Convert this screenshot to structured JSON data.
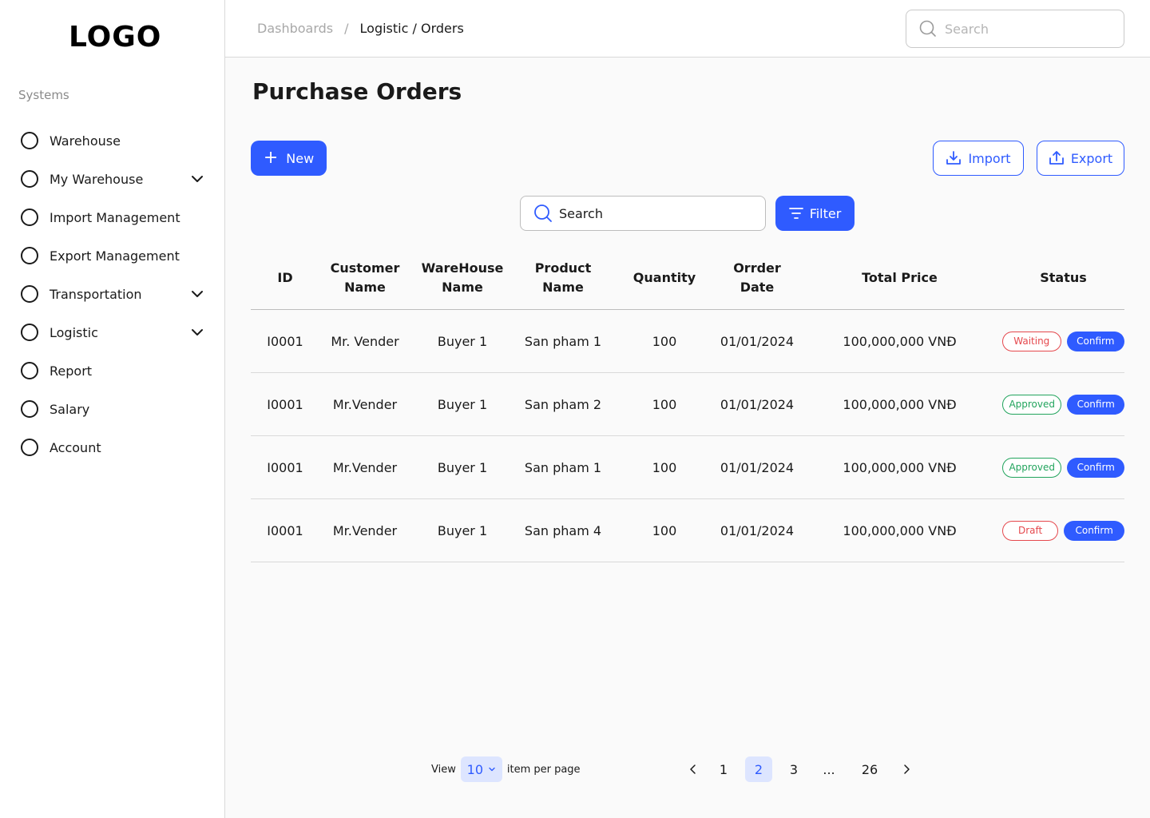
{
  "brand": {
    "logo": "LOGO"
  },
  "sidebar": {
    "section_label": "Systems",
    "items": [
      {
        "label": "Warehouse",
        "has_chevron": false
      },
      {
        "label": "My Warehouse",
        "has_chevron": true
      },
      {
        "label": "Import Management",
        "has_chevron": false
      },
      {
        "label": "Export Management",
        "has_chevron": false
      },
      {
        "label": "Transportation",
        "has_chevron": true
      },
      {
        "label": "Logistic",
        "has_chevron": true
      },
      {
        "label": "Report",
        "has_chevron": false
      },
      {
        "label": "Salary",
        "has_chevron": false
      },
      {
        "label": "Account",
        "has_chevron": false
      }
    ]
  },
  "header": {
    "breadcrumb": {
      "root": "Dashboards",
      "separator": "/",
      "current": "Logistic / Orders"
    },
    "search_placeholder": "Search"
  },
  "page": {
    "title": "Purchase Orders"
  },
  "toolbar": {
    "new_label": "New",
    "import_label": "Import",
    "export_label": "Export",
    "search_placeholder": "Search",
    "filter_label": "Filter"
  },
  "table": {
    "headers": {
      "id": "ID",
      "customer_line1": "Customer",
      "customer_line2": "Name",
      "warehouse_line1": "WareHouse",
      "warehouse_line2": "Name",
      "product_line1": "Product",
      "product_line2": "Name",
      "quantity": "Quantity",
      "date_line1": "Orrder",
      "date_line2": "Date",
      "total": "Total Price",
      "status": "Status"
    },
    "rows": [
      {
        "id": "I0001",
        "customer": "Mr. Vender",
        "warehouse": "Buyer 1",
        "product": "San pham 1",
        "quantity": "100",
        "date": "01/01/2024",
        "total": "100,000,000 VNĐ",
        "status": "Waiting",
        "action": "Confirm"
      },
      {
        "id": "I0001",
        "customer": "Mr.Vender",
        "warehouse": "Buyer 1",
        "product": "San pham 2",
        "quantity": "100",
        "date": "01/01/2024",
        "total": "100,000,000 VNĐ",
        "status": "Approved",
        "action": "Confirm"
      },
      {
        "id": "I0001",
        "customer": "Mr.Vender",
        "warehouse": "Buyer 1",
        "product": "San pham 1",
        "quantity": "100",
        "date": "01/01/2024",
        "total": "100,000,000 VNĐ",
        "status": "Approved",
        "action": "Confirm"
      },
      {
        "id": "I0001",
        "customer": "Mr.Vender",
        "warehouse": "Buyer 1",
        "product": "San pham 4",
        "quantity": "100",
        "date": "01/01/2024",
        "total": "100,000,000 VNĐ",
        "status": "Draft",
        "action": "Confirm"
      }
    ]
  },
  "pagination": {
    "view_label": "View",
    "per_page_value": "10",
    "per_page_suffix": "item per page",
    "pages": [
      "1",
      "2",
      "3",
      "...",
      "26"
    ],
    "current_page": "2"
  },
  "colors": {
    "primary": "#2f5bff",
    "primary_light": "#dde5ff",
    "waiting": "#e5484d",
    "approved": "#22a45d",
    "draft": "#e5484d"
  }
}
